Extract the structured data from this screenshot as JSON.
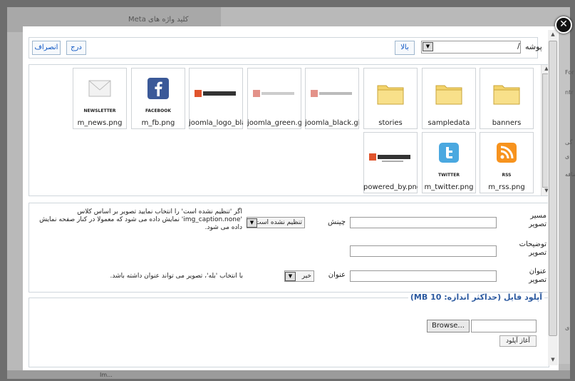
{
  "background": {
    "meta_heading": "کلید واژه های Meta",
    "footer_text": "Im...",
    "right_texts": [
      "For",
      "ntr",
      "گی",
      "ی",
      "اضافه",
      "ی"
    ]
  },
  "toolbar": {
    "cancel_label": "انصراف",
    "insert_label": "درج",
    "up_label": "بالا",
    "directory_label": "پوشه",
    "directory_value": "/"
  },
  "files": [
    {
      "name": "banners",
      "kind": "folder"
    },
    {
      "name": "sampledata",
      "kind": "folder"
    },
    {
      "name": "stories",
      "kind": "folder"
    },
    {
      "name": "joomla_black.gif",
      "kind": "image",
      "icon": "joomla-logo-icon",
      "style": "faded"
    },
    {
      "name": "joomla_green.gif",
      "kind": "image",
      "icon": "joomla-logo-icon",
      "style": "faded"
    },
    {
      "name": "joomla_logo_black.jpg",
      "kind": "image",
      "icon": "joomla-logo-icon",
      "style": "bold"
    },
    {
      "name": "m_fb.png",
      "kind": "image",
      "icon": "facebook-icon",
      "caption": "FACEBOOK"
    },
    {
      "name": "m_news.png",
      "kind": "image",
      "icon": "envelope-icon",
      "caption": "NEWSLETTER"
    },
    {
      "name": "m_rss.png",
      "kind": "image",
      "icon": "rss-icon",
      "caption": "RSS"
    },
    {
      "name": "m_twitter.png",
      "kind": "image",
      "icon": "twitter-icon",
      "caption": "TWITTER"
    },
    {
      "name": "powered_by.png",
      "kind": "image",
      "icon": "joomla-powered-icon"
    }
  ],
  "image_props": {
    "url_label": "مسیر تصویر",
    "align_label": "چینش",
    "align_value": "تنظیم نشده است",
    "align_note": "اگر 'تنظیم نشده است' را انتخاب نمایید تصویر بر اساس کلاس 'img_caption.none' نمایش داده می شود که معمولا در کنار صفحه نمایش داده می شود.",
    "desc_label": "توضیحات تصویر",
    "title_label": "عنوان تصویر",
    "caption_label": "عنوان",
    "caption_value": "خیر",
    "caption_note": "با انتخاب 'بله'، تصویر می تواند عنوان داشته باشد."
  },
  "upload": {
    "legend": "آپلود فایل (حداکثر اندازه: 10 MB)",
    "browse_label": "Browse...",
    "start_label": "آغاز آپلود"
  },
  "colors": {
    "accent": "#0b55c4",
    "legend": "#2c5aa0",
    "overlay": "#6e6e6e"
  }
}
